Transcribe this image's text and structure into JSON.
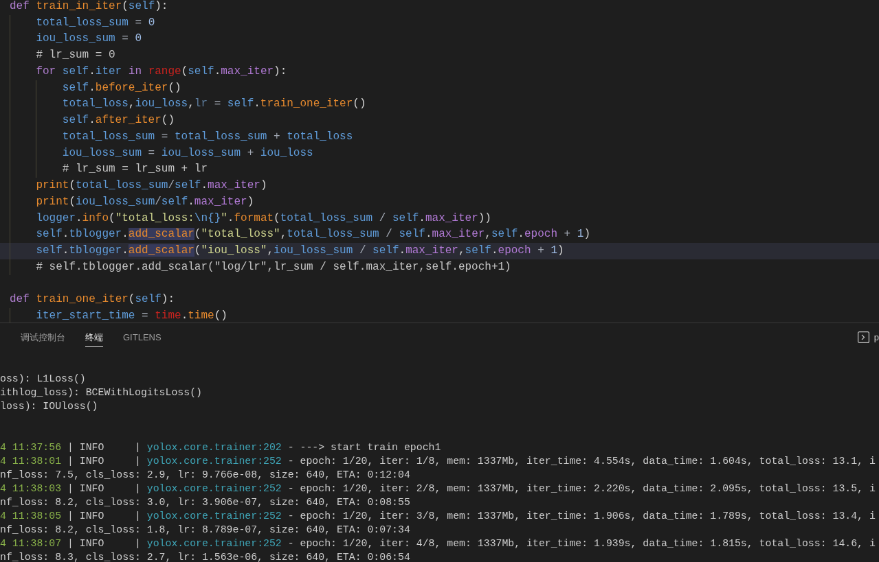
{
  "editor": {
    "blocks": [
      {
        "current": false,
        "tokens": [
          {
            "text": "def ",
            "kind": "keyword"
          },
          {
            "text": "train_in_iter",
            "kind": "function"
          },
          {
            "text": "(",
            "kind": "punct"
          },
          {
            "text": "self",
            "kind": "variable"
          },
          {
            "text": "):",
            "kind": "punct"
          }
        ],
        "children": [
          {
            "current": false,
            "tokens": [
              {
                "text": "total_loss_sum",
                "kind": "variable"
              },
              {
                "text": " = ",
                "kind": "operator"
              },
              {
                "text": "0",
                "kind": "number"
              }
            ]
          },
          {
            "current": false,
            "tokens": [
              {
                "text": "iou_loss_sum",
                "kind": "variable"
              },
              {
                "text": " = ",
                "kind": "operator"
              },
              {
                "text": "0",
                "kind": "number"
              }
            ]
          },
          {
            "current": false,
            "tokens": [
              {
                "text": "# lr_sum = 0",
                "kind": "comment"
              }
            ]
          },
          {
            "current": false,
            "tokens": [
              {
                "text": "for ",
                "kind": "keyword"
              },
              {
                "text": "self",
                "kind": "variable"
              },
              {
                "text": ".",
                "kind": "punct"
              },
              {
                "text": "iter",
                "kind": "variable"
              },
              {
                "text": " in ",
                "kind": "keyword"
              },
              {
                "text": "range",
                "kind": "builtin"
              },
              {
                "text": "(",
                "kind": "punct"
              },
              {
                "text": "self",
                "kind": "variable"
              },
              {
                "text": ".",
                "kind": "punct"
              },
              {
                "text": "max_iter",
                "kind": "property"
              },
              {
                "text": "):",
                "kind": "punct"
              }
            ],
            "children": [
              {
                "current": false,
                "tokens": [
                  {
                    "text": "self",
                    "kind": "variable"
                  },
                  {
                    "text": ".",
                    "kind": "punct"
                  },
                  {
                    "text": "before_iter",
                    "kind": "function"
                  },
                  {
                    "text": "()",
                    "kind": "punct"
                  }
                ]
              },
              {
                "current": false,
                "tokens": [
                  {
                    "text": "total_loss",
                    "kind": "variable"
                  },
                  {
                    "text": ",",
                    "kind": "punct"
                  },
                  {
                    "text": "iou_loss",
                    "kind": "variable"
                  },
                  {
                    "text": ",",
                    "kind": "punct"
                  },
                  {
                    "text": "lr",
                    "kind": "unused"
                  },
                  {
                    "text": " = ",
                    "kind": "operator"
                  },
                  {
                    "text": "self",
                    "kind": "variable"
                  },
                  {
                    "text": ".",
                    "kind": "punct"
                  },
                  {
                    "text": "train_one_iter",
                    "kind": "function"
                  },
                  {
                    "text": "()",
                    "kind": "punct"
                  }
                ]
              },
              {
                "current": false,
                "tokens": [
                  {
                    "text": "self",
                    "kind": "variable"
                  },
                  {
                    "text": ".",
                    "kind": "punct"
                  },
                  {
                    "text": "after_iter",
                    "kind": "function"
                  },
                  {
                    "text": "()",
                    "kind": "punct"
                  }
                ]
              },
              {
                "current": false,
                "tokens": [
                  {
                    "text": "total_loss_sum",
                    "kind": "variable"
                  },
                  {
                    "text": " = ",
                    "kind": "operator"
                  },
                  {
                    "text": "total_loss_sum",
                    "kind": "variable"
                  },
                  {
                    "text": " + ",
                    "kind": "operator"
                  },
                  {
                    "text": "total_loss",
                    "kind": "variable"
                  }
                ]
              },
              {
                "current": false,
                "tokens": [
                  {
                    "text": "iou_loss_sum",
                    "kind": "variable"
                  },
                  {
                    "text": " = ",
                    "kind": "operator"
                  },
                  {
                    "text": "iou_loss_sum",
                    "kind": "variable"
                  },
                  {
                    "text": " + ",
                    "kind": "operator"
                  },
                  {
                    "text": "iou_loss",
                    "kind": "variable"
                  }
                ]
              },
              {
                "current": false,
                "tokens": [
                  {
                    "text": "# lr_sum = lr_sum + lr",
                    "kind": "comment"
                  }
                ]
              }
            ]
          },
          {
            "current": false,
            "tokens": [
              {
                "text": "print",
                "kind": "function"
              },
              {
                "text": "(",
                "kind": "punct"
              },
              {
                "text": "total_loss_sum",
                "kind": "variable"
              },
              {
                "text": "/",
                "kind": "operator"
              },
              {
                "text": "self",
                "kind": "variable"
              },
              {
                "text": ".",
                "kind": "punct"
              },
              {
                "text": "max_iter",
                "kind": "property"
              },
              {
                "text": ")",
                "kind": "punct"
              }
            ]
          },
          {
            "current": false,
            "tokens": [
              {
                "text": "print",
                "kind": "function"
              },
              {
                "text": "(",
                "kind": "punct"
              },
              {
                "text": "iou_loss_sum",
                "kind": "variable"
              },
              {
                "text": "/",
                "kind": "operator"
              },
              {
                "text": "self",
                "kind": "variable"
              },
              {
                "text": ".",
                "kind": "punct"
              },
              {
                "text": "max_iter",
                "kind": "property"
              },
              {
                "text": ")",
                "kind": "punct"
              }
            ]
          },
          {
            "current": false,
            "tokens": [
              {
                "text": "logger",
                "kind": "variable"
              },
              {
                "text": ".",
                "kind": "punct"
              },
              {
                "text": "info",
                "kind": "function"
              },
              {
                "text": "(",
                "kind": "punct"
              },
              {
                "text": "\"total_loss:",
                "kind": "string"
              },
              {
                "text": "\\n{}",
                "kind": "escape"
              },
              {
                "text": "\"",
                "kind": "string"
              },
              {
                "text": ".",
                "kind": "punct"
              },
              {
                "text": "format",
                "kind": "function"
              },
              {
                "text": "(",
                "kind": "punct"
              },
              {
                "text": "total_loss_sum",
                "kind": "variable"
              },
              {
                "text": " / ",
                "kind": "operator"
              },
              {
                "text": "self",
                "kind": "variable"
              },
              {
                "text": ".",
                "kind": "punct"
              },
              {
                "text": "max_iter",
                "kind": "property"
              },
              {
                "text": "))",
                "kind": "punct"
              }
            ]
          },
          {
            "current": false,
            "tokens": [
              {
                "text": "self",
                "kind": "variable"
              },
              {
                "text": ".",
                "kind": "punct"
              },
              {
                "text": "tblogger",
                "kind": "variable"
              },
              {
                "text": ".",
                "kind": "punct"
              },
              {
                "text": "add_scalar",
                "kind": "match"
              },
              {
                "text": "(",
                "kind": "punct"
              },
              {
                "text": "\"total_loss\"",
                "kind": "string"
              },
              {
                "text": ",",
                "kind": "punct"
              },
              {
                "text": "total_loss_sum",
                "kind": "variable"
              },
              {
                "text": " / ",
                "kind": "operator"
              },
              {
                "text": "self",
                "kind": "variable"
              },
              {
                "text": ".",
                "kind": "punct"
              },
              {
                "text": "max_iter",
                "kind": "property"
              },
              {
                "text": ",",
                "kind": "punct"
              },
              {
                "text": "self",
                "kind": "variable"
              },
              {
                "text": ".",
                "kind": "punct"
              },
              {
                "text": "epoch",
                "kind": "property"
              },
              {
                "text": " + ",
                "kind": "operator"
              },
              {
                "text": "1",
                "kind": "number"
              },
              {
                "text": ")",
                "kind": "punct"
              }
            ]
          },
          {
            "current": true,
            "tokens": [
              {
                "text": "self",
                "kind": "variable"
              },
              {
                "text": ".",
                "kind": "punct"
              },
              {
                "text": "tblogger",
                "kind": "variable"
              },
              {
                "text": ".",
                "kind": "punct"
              },
              {
                "text": "add_scalar",
                "kind": "match"
              },
              {
                "text": "(",
                "kind": "punct"
              },
              {
                "text": "\"iou_loss\"",
                "kind": "string"
              },
              {
                "text": ",",
                "kind": "punct"
              },
              {
                "text": "iou_loss_sum",
                "kind": "variable"
              },
              {
                "text": " / ",
                "kind": "operator"
              },
              {
                "text": "self",
                "kind": "variable"
              },
              {
                "text": ".",
                "kind": "punct"
              },
              {
                "text": "max_iter",
                "kind": "property"
              },
              {
                "text": ",",
                "kind": "punct"
              },
              {
                "text": "self",
                "kind": "variable"
              },
              {
                "text": ".",
                "kind": "punct"
              },
              {
                "text": "epoch",
                "kind": "property"
              },
              {
                "text": " + ",
                "kind": "operator"
              },
              {
                "text": "1",
                "kind": "number"
              },
              {
                "text": ")",
                "kind": "punct"
              }
            ]
          },
          {
            "current": false,
            "tokens": [
              {
                "text": "# self.tblogger.add_scalar(\"log/lr\",lr_sum / self.max_iter,self.epoch+1)",
                "kind": "comment"
              }
            ]
          }
        ]
      },
      {
        "current": false,
        "tokens": [
          {
            "text": "def ",
            "kind": "keyword"
          },
          {
            "text": "train_one_iter",
            "kind": "function"
          },
          {
            "text": "(",
            "kind": "punct"
          },
          {
            "text": "self",
            "kind": "variable"
          },
          {
            "text": "):",
            "kind": "punct"
          }
        ],
        "children": [
          {
            "current": false,
            "tokens": [
              {
                "text": "iter_start_time",
                "kind": "variable"
              },
              {
                "text": " = ",
                "kind": "operator"
              },
              {
                "text": "time",
                "kind": "builtin"
              },
              {
                "text": ".",
                "kind": "punct"
              },
              {
                "text": "time",
                "kind": "function"
              },
              {
                "text": "()",
                "kind": "punct"
              }
            ]
          }
        ]
      }
    ]
  },
  "panel": {
    "tabs": [
      {
        "label": "调试控制台",
        "selected": false
      },
      {
        "label": "终端",
        "selected": true
      },
      {
        "label": "GITLENS",
        "selected": false
      }
    ],
    "terminal_name": "p",
    "terminal": {
      "blocks": [
        {
          "lines": [
            [
              {
                "text": "oss): L1Loss()",
                "kind": "text"
              }
            ],
            [
              {
                "text": "ithlog_loss): BCEWithLogitsLoss()",
                "kind": "text"
              }
            ],
            [
              {
                "text": "loss): IOUloss()",
                "kind": "text"
              }
            ]
          ]
        },
        {
          "lines": [
            [
              {
                "text": "4 11:37:56",
                "kind": "time"
              },
              {
                "text": " | INFO     | ",
                "kind": "text"
              },
              {
                "text": "yolox.core.trainer:202",
                "kind": "source"
              },
              {
                "text": " - ---> start train epoch1",
                "kind": "text"
              }
            ],
            [
              {
                "text": "4 11:38:01",
                "kind": "time"
              },
              {
                "text": " | INFO     | ",
                "kind": "text"
              },
              {
                "text": "yolox.core.trainer:252",
                "kind": "source"
              },
              {
                "text": " - epoch: 1/20, iter: 1/8, mem: 1337Mb, iter_time: 4.554s, data_time: 1.604s, total_loss: 13.1, i",
                "kind": "text"
              }
            ],
            [
              {
                "text": "nf_loss: 7.5, cls_loss: 2.9, lr: 9.766e-08, size: 640, ETA: 0:12:04",
                "kind": "text"
              }
            ],
            [
              {
                "text": "4 11:38:03",
                "kind": "time"
              },
              {
                "text": " | INFO     | ",
                "kind": "text"
              },
              {
                "text": "yolox.core.trainer:252",
                "kind": "source"
              },
              {
                "text": " - epoch: 1/20, iter: 2/8, mem: 1337Mb, iter_time: 2.220s, data_time: 2.095s, total_loss: 13.5, i",
                "kind": "text"
              }
            ],
            [
              {
                "text": "nf_loss: 8.2, cls_loss: 3.0, lr: 3.906e-07, size: 640, ETA: 0:08:55",
                "kind": "text"
              }
            ],
            [
              {
                "text": "4 11:38:05",
                "kind": "time"
              },
              {
                "text": " | INFO     | ",
                "kind": "text"
              },
              {
                "text": "yolox.core.trainer:252",
                "kind": "source"
              },
              {
                "text": " - epoch: 1/20, iter: 3/8, mem: 1337Mb, iter_time: 1.906s, data_time: 1.789s, total_loss: 13.4, i",
                "kind": "text"
              }
            ],
            [
              {
                "text": "nf_loss: 8.2, cls_loss: 1.8, lr: 8.789e-07, size: 640, ETA: 0:07:34",
                "kind": "text"
              }
            ],
            [
              {
                "text": "4 11:38:07",
                "kind": "time"
              },
              {
                "text": " | INFO     | ",
                "kind": "text"
              },
              {
                "text": "yolox.core.trainer:252",
                "kind": "source"
              },
              {
                "text": " - epoch: 1/20, iter: 4/8, mem: 1337Mb, iter_time: 1.939s, data_time: 1.815s, total_loss: 14.6, i",
                "kind": "text"
              }
            ],
            [
              {
                "text": "nf_loss: 8.3, cls_loss: 2.7, lr: 1.563e-06, size: 640, ETA: 0:06:54",
                "kind": "text"
              }
            ]
          ]
        }
      ]
    }
  }
}
